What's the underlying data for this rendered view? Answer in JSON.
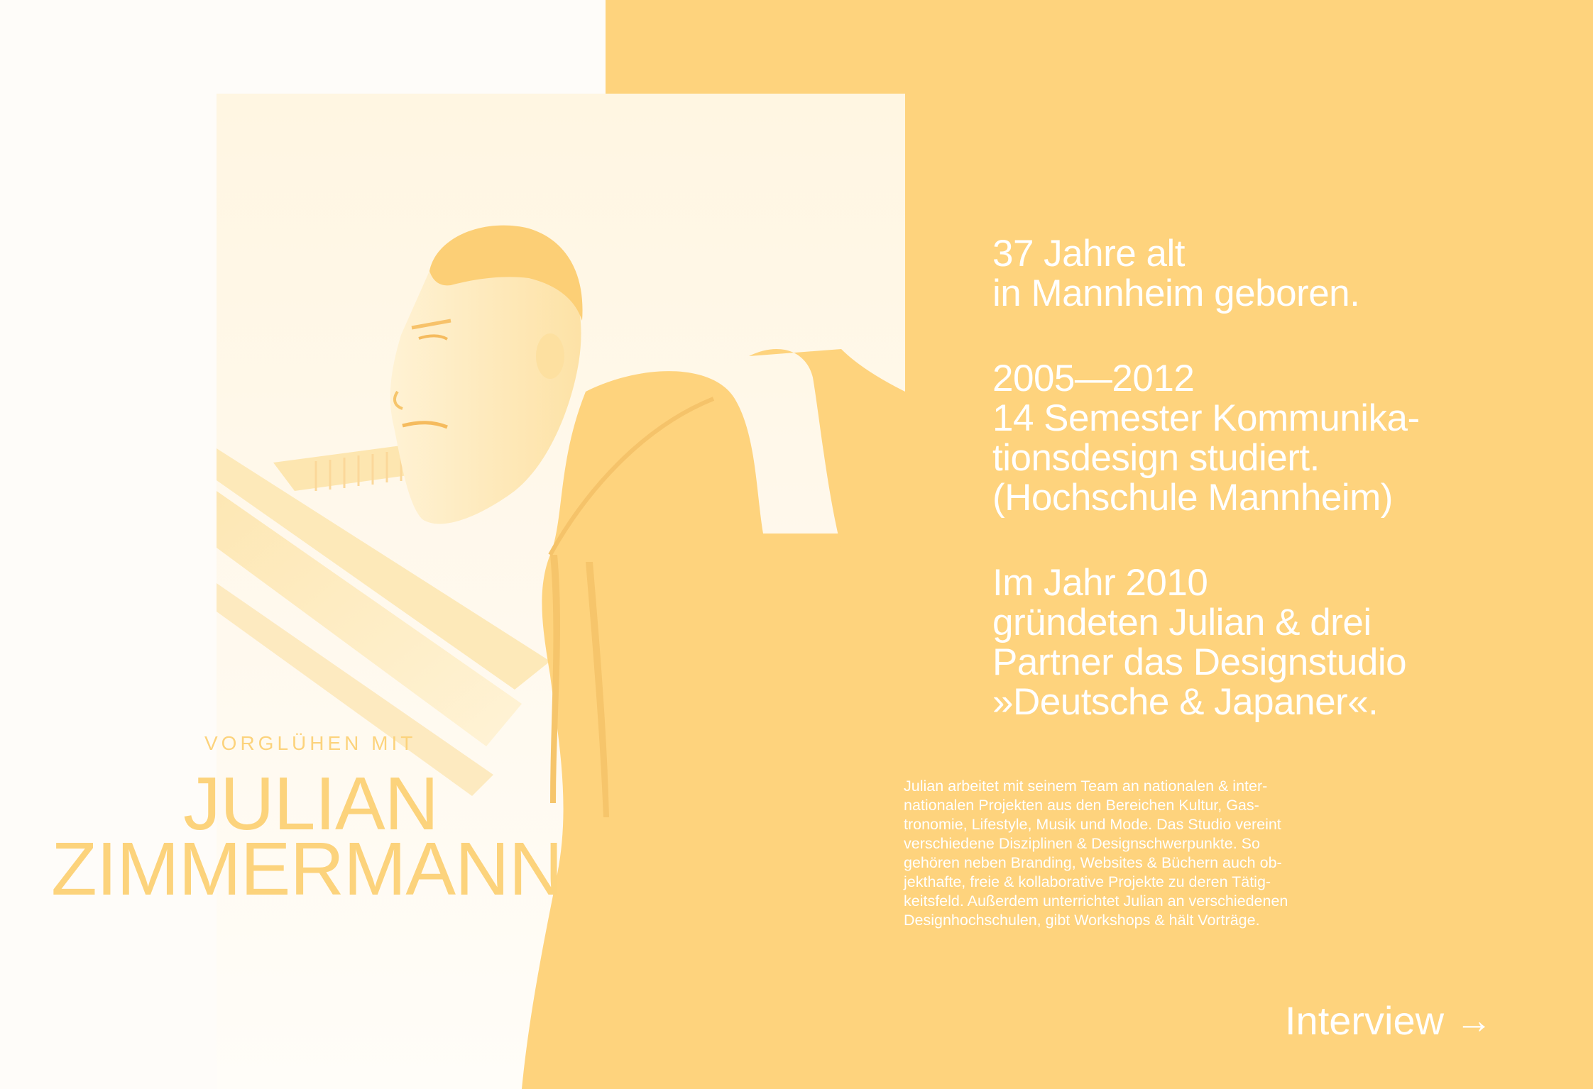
{
  "colors": {
    "accent": "#fed37d",
    "name_text": "#fcd37c",
    "light_text": "#ffffff",
    "background": "#fefcf9"
  },
  "bio": {
    "blocks": [
      [
        "37 Jahre alt",
        "in Mannheim geboren."
      ],
      [
        "2005—2012",
        "14 Semester Kommunika-",
        "tionsdesign studiert.",
        "(Hochschule Mannheim)"
      ],
      [
        "Im Jahr 2010",
        "gründeten Julian & drei",
        "Partner das Designstudio",
        "»Deutsche & Japaner«."
      ]
    ]
  },
  "description": {
    "lines": [
      "Julian arbeitet mit seinem Team an nationalen & inter-",
      "nationalen Projekten aus den Bereichen Kultur, Gas-",
      "tronomie, Lifestyle, Musik und Mode. Das Studio vereint",
      "verschiedene Disziplinen & Designschwerpunkte. So",
      "gehören neben Branding, Websites & Büchern auch ob-",
      "jekthafte, freie & kollaborative Projekte zu deren Tätig-",
      "keitsfeld. Außerdem unterrichtet Julian an verschiedenen",
      "Designhochschulen, gibt Workshops & hält Vorträge."
    ]
  },
  "heading": {
    "kicker": "VORGLÜHEN MIT",
    "first_name": "JULIAN",
    "last_name": "ZIMMERMANN"
  },
  "cta": {
    "label": "Interview",
    "arrow": "→"
  }
}
